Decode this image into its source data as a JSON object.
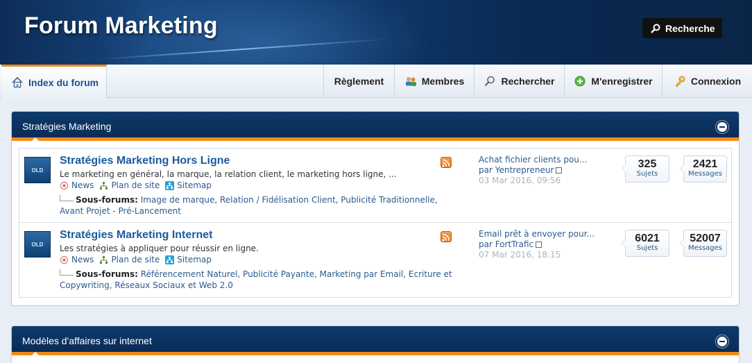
{
  "header": {
    "site_title": "Forum Marketing",
    "search_button": "Recherche"
  },
  "navbar": {
    "index": "Index du forum",
    "items": [
      {
        "label": "Règlement"
      },
      {
        "label": "Membres"
      },
      {
        "label": "Rechercher"
      },
      {
        "label": "M'enregistrer"
      },
      {
        "label": "Connexion"
      }
    ]
  },
  "categories": [
    {
      "title": "Stratégies Marketing",
      "forums": [
        {
          "icon_text": "OLD",
          "name": "Stratégies Marketing Hors Ligne",
          "description": "Le marketing en général, la marque, la relation client, le marketing hors ligne, ...",
          "links": {
            "news": "News",
            "plan": "Plan de site",
            "sitemap": "Sitemap"
          },
          "subforums_label": "Sous-forums:",
          "subforums": "Image de marque, Relation / Fidélisation Client, Publicité Traditionnelle, Avant Projet - Pré-Lancement",
          "lastpost": {
            "title": "Achat fichier clients pou...",
            "by": "par Yentrepreneur",
            "date": "03 Mar 2016, 09:56"
          },
          "topics": "325",
          "topics_label": "Sujets",
          "messages": "2421",
          "messages_label": "Messages"
        },
        {
          "icon_text": "OLD",
          "name": "Stratégies Marketing Internet",
          "description": "Les stratégies à appliquer pour réussir en ligne.",
          "links": {
            "news": "News",
            "plan": "Plan de site",
            "sitemap": "Sitemap"
          },
          "subforums_label": "Sous-forums:",
          "subforums": "Référencement Naturel, Publicité Payante, Marketing par Email, Ecriture et Copywriting, Réseaux Sociaux et Web 2.0",
          "lastpost": {
            "title": "Email prêt à envoyer pour...",
            "by": "par FortTrafic",
            "date": "07 Mar 2016, 18:15"
          },
          "topics": "6021",
          "topics_label": "Sujets",
          "messages": "52007",
          "messages_label": "Messages"
        }
      ]
    },
    {
      "title": "Modèles d'affaires sur internet"
    }
  ],
  "colors": {
    "accent": "#f08a1c",
    "header_dark": "#0a2c56",
    "link": "#1a5a9e"
  }
}
